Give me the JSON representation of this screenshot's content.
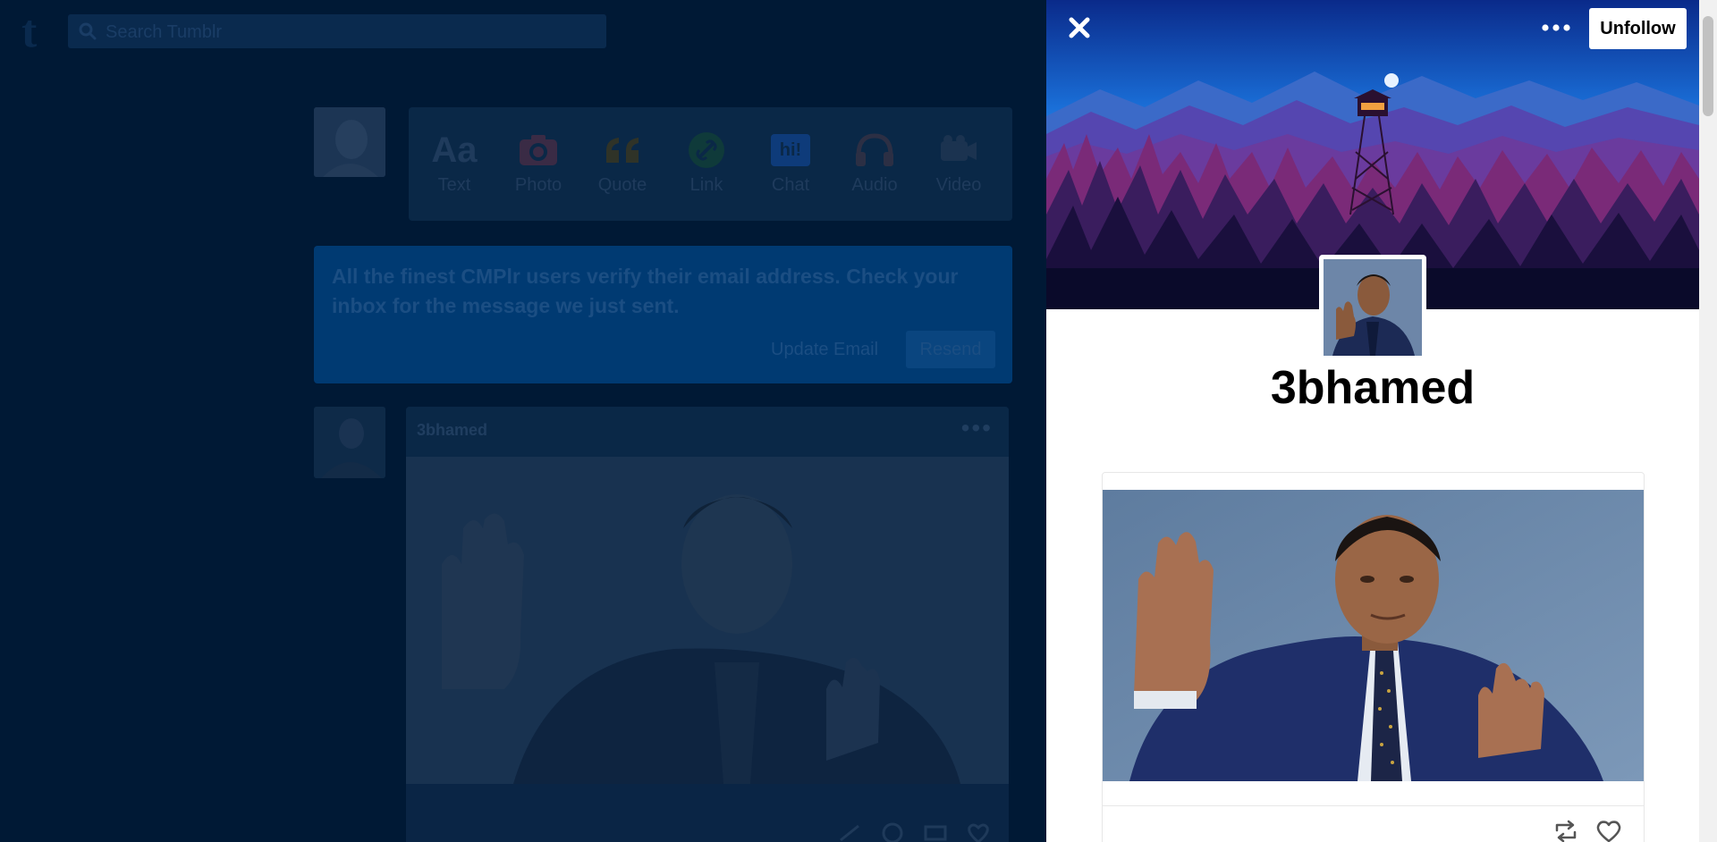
{
  "dashboard": {
    "logo": "t",
    "search_placeholder": "Search Tumblr",
    "composer": [
      {
        "label": "Text",
        "icon": "text-aa-icon"
      },
      {
        "label": "Photo",
        "icon": "camera-icon"
      },
      {
        "label": "Quote",
        "icon": "quote-icon"
      },
      {
        "label": "Link",
        "icon": "link-icon"
      },
      {
        "label": "Chat",
        "icon": "chat-icon"
      },
      {
        "label": "Audio",
        "icon": "headphones-icon"
      },
      {
        "label": "Video",
        "icon": "video-camera-icon"
      }
    ],
    "composer_text_glyph": "Aa",
    "composer_chat_glyph": "hi!",
    "banner": {
      "message": "All the finest CMPlr users verify their email address. Check your inbox for the message we just sent.",
      "update_email": "Update Email",
      "resend": "Resend"
    },
    "post": {
      "blog_name": "3bhamed",
      "more_glyph": "•••"
    }
  },
  "panel": {
    "unfollow_label": "Unfollow",
    "more_glyph": "•••",
    "blog_title": "3bhamed"
  },
  "colors": {
    "overlay_bg": "#001935",
    "panel_bg": "#ffffff"
  }
}
